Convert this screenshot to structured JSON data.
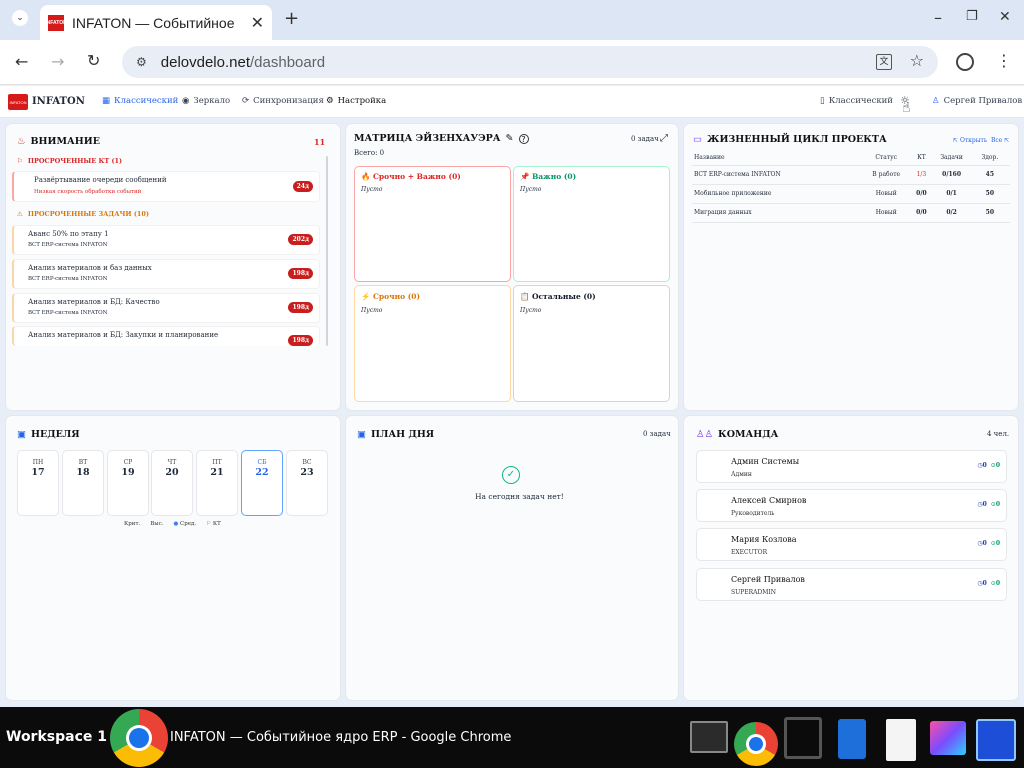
{
  "browser": {
    "tab_title": "INFATON — Событийное ядро ERP",
    "tab_favicon_text": "INFATON",
    "url_domain": "delovdelo.net",
    "url_path": "/dashboard"
  },
  "app": {
    "logo_text": "INFATON",
    "logo_badge": "INFATON",
    "nav": [
      "Классический",
      "Зеркало",
      "Синхронизация",
      "Настройка"
    ],
    "mode_label": "Классический",
    "user_name": "Сергей Привалов"
  },
  "attention": {
    "title": "ВНИМАНИЕ",
    "count": "11",
    "overdue_kt_title": "ПРОСРОЧЕННЫЕ КТ (1)",
    "kt_items": [
      {
        "title": "Развёртывание очереди сообщений",
        "sub": "Низкая скорость обработки событий",
        "badge": "24д"
      }
    ],
    "overdue_tasks_title": "ПРОСРОЧЕННЫЕ ЗАДАЧИ (10)",
    "task_items": [
      {
        "title": "Аванс 50% по этапу 1",
        "sub": "ВСТ ERP-система INFATON",
        "badge": "202д"
      },
      {
        "title": "Анализ материалов и баз данных",
        "sub": "ВСТ ERP-система INFATON",
        "badge": "198д"
      },
      {
        "title": "Анализ материалов и БД: Качество",
        "sub": "ВСТ ERP-система INFATON",
        "badge": "198д"
      },
      {
        "title": "Анализ материалов и БД: Закупки и планирование",
        "sub": "",
        "badge": "198д"
      }
    ]
  },
  "matrix": {
    "title": "МАТРИЦА ЭЙЗЕНХАУЭРА",
    "tasks": "0 задач",
    "total": "Всего: 0",
    "quadrants": [
      {
        "title": "🔥 Срочно + Важно (0)",
        "empty": "Пусто",
        "color": "#dc2626"
      },
      {
        "title": "📌 Важно (0)",
        "empty": "Пусто",
        "color": "#059669"
      },
      {
        "title": "⚡ Срочно (0)",
        "empty": "Пусто",
        "color": "#d97706"
      },
      {
        "title": "📋 Остальные (0)",
        "empty": "Пусто",
        "color": "#111827"
      }
    ]
  },
  "lifecycle": {
    "title": "ЖИЗНЕННЫЙ ЦИКЛ ПРОЕКТА",
    "open": "Открыть",
    "all": "Все",
    "columns": [
      "Название",
      "Статус",
      "КТ",
      "Задачи",
      "Здор."
    ],
    "rows": [
      {
        "name": "ВСТ ERP-система INFATON",
        "status": "В работе",
        "kt": "1/3",
        "tasks": "0/160",
        "health": "45"
      },
      {
        "name": "Мобильное приложение",
        "status": "Новый",
        "kt": "0/0",
        "tasks": "0/1",
        "health": "50"
      },
      {
        "name": "Миграция данных",
        "status": "Новый",
        "kt": "0/0",
        "tasks": "0/2",
        "health": "50"
      }
    ]
  },
  "week": {
    "title": "НЕДЕЛЯ",
    "days": [
      {
        "dn": "ПН",
        "dd": "17"
      },
      {
        "dn": "ВТ",
        "dd": "18"
      },
      {
        "dn": "СР",
        "dd": "19"
      },
      {
        "dn": "ЧТ",
        "dd": "20"
      },
      {
        "dn": "ПТ",
        "dd": "21"
      },
      {
        "dn": "СБ",
        "dd": "22"
      },
      {
        "dn": "ВС",
        "dd": "23"
      }
    ],
    "legend": [
      "Крит.",
      "Выс.",
      "Сред.",
      "КТ"
    ]
  },
  "plan": {
    "title": "ПЛАН ДНЯ",
    "tasks": "0 задач",
    "empty": "На сегодня задач нет!"
  },
  "team": {
    "title": "КОМАНДА",
    "count": "4 чел.",
    "members": [
      {
        "name": "Админ Системы",
        "role": "Админ",
        "a": "0",
        "b": "0"
      },
      {
        "name": "Алексей Смирнов",
        "role": "Руководитель",
        "a": "0",
        "b": "0"
      },
      {
        "name": "Мария Козлова",
        "role": "EXECUTOR",
        "a": "0",
        "b": "0"
      },
      {
        "name": "Сергей Привалов",
        "role": "SUPERADMIN",
        "a": "0",
        "b": "0"
      }
    ]
  },
  "taskbar": {
    "workspace": "Workspace 1",
    "window_title": "INFATON — Событийное ядро ERP - Google Chrome"
  }
}
